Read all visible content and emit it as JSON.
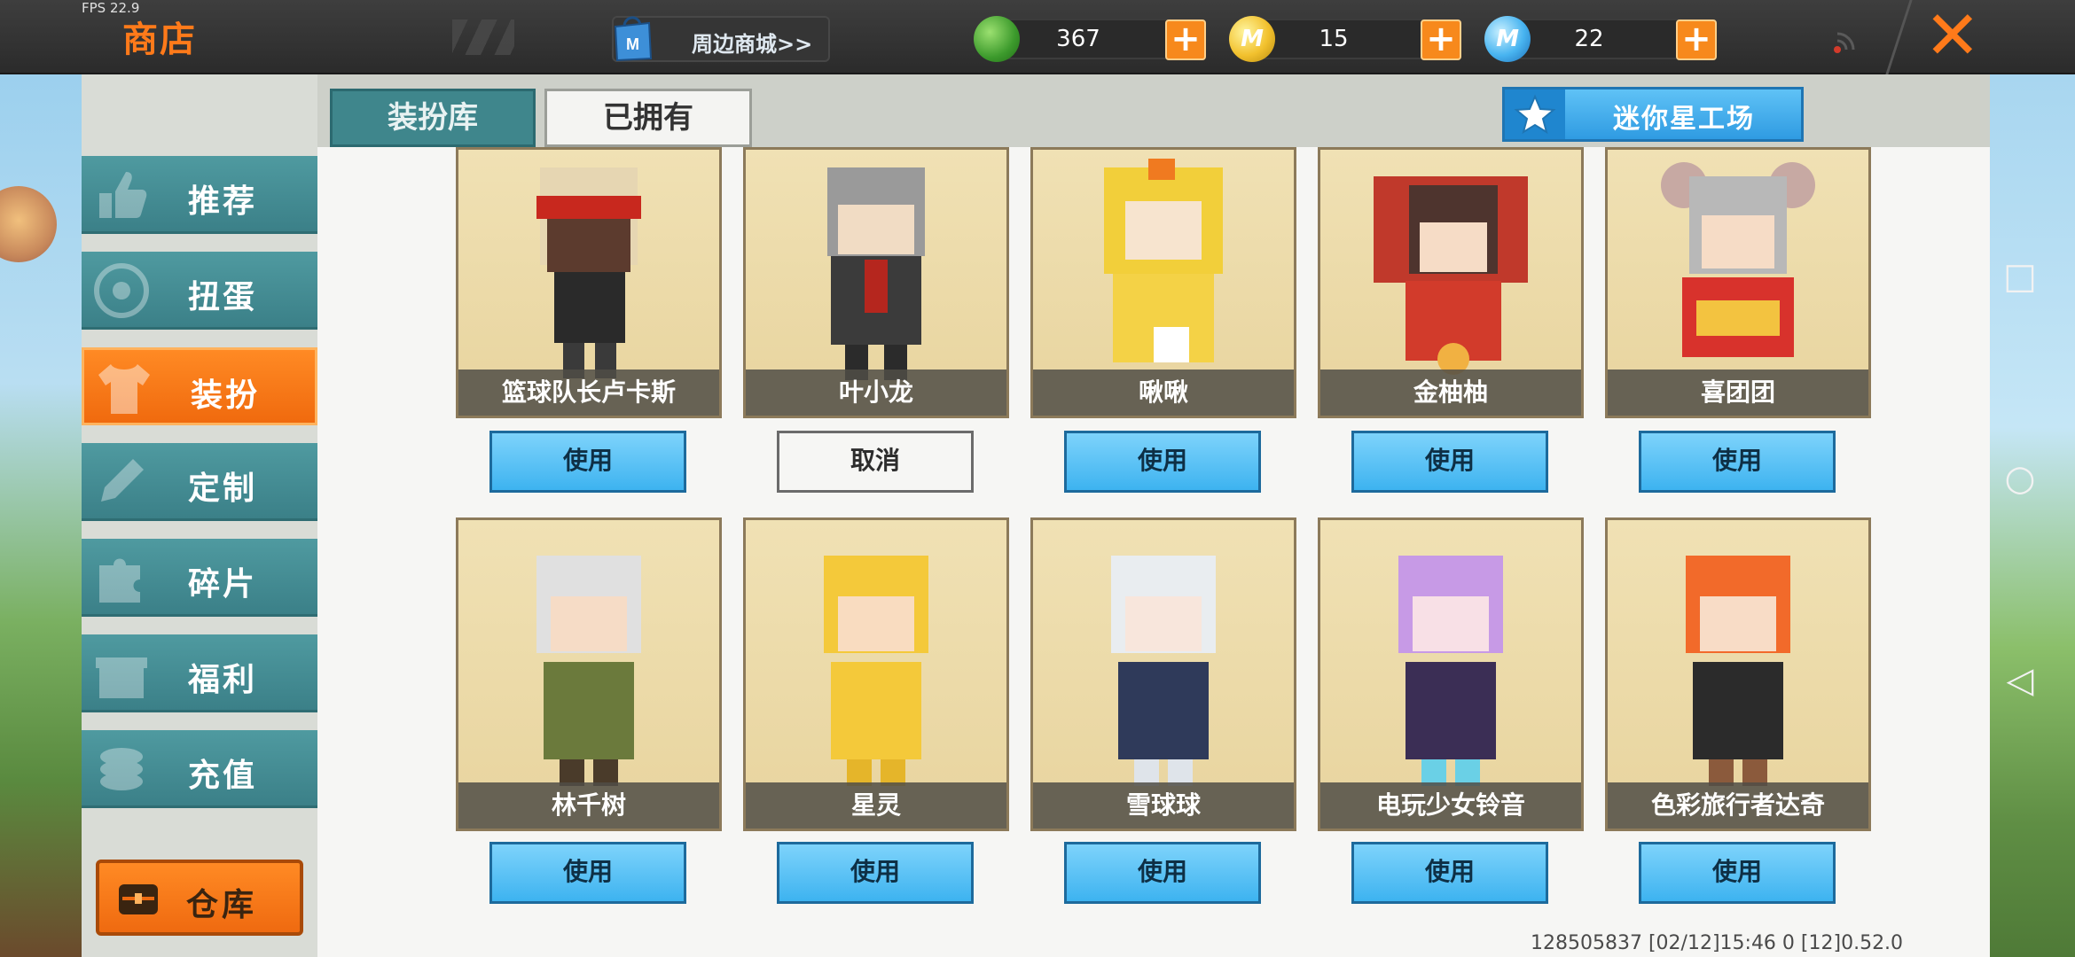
{
  "topbar": {
    "fps": "FPS 22.9",
    "title": "商店",
    "mall_link": "周边商城>>",
    "close_icon": "close-icon"
  },
  "currencies": [
    {
      "icon": "green-gem-icon",
      "value": "367"
    },
    {
      "icon": "gold-coin-icon",
      "value": "15"
    },
    {
      "icon": "mini-coin-icon",
      "value": "22"
    }
  ],
  "sidebar": {
    "items": [
      {
        "label": "推荐",
        "icon": "thumbs-up-icon"
      },
      {
        "label": "扭蛋",
        "icon": "capsule-icon"
      },
      {
        "label": "装扮",
        "icon": "tshirt-icon",
        "active": true
      },
      {
        "label": "定制",
        "icon": "pencil-icon"
      },
      {
        "label": "碎片",
        "icon": "puzzle-icon"
      },
      {
        "label": "福利",
        "icon": "gift-icon"
      },
      {
        "label": "充值",
        "icon": "coins-icon"
      }
    ],
    "warehouse": "仓库"
  },
  "tabs": [
    {
      "label": "装扮库",
      "selected": false
    },
    {
      "label": "已拥有",
      "selected": true
    }
  ],
  "workshop_label": "迷你星工场",
  "items": [
    {
      "name": "篮球队长卢卡斯",
      "action": "使用"
    },
    {
      "name": "叶小龙",
      "action": "取消"
    },
    {
      "name": "啾啾",
      "action": "使用"
    },
    {
      "name": "金柚柚",
      "action": "使用"
    },
    {
      "name": "喜团团",
      "action": "使用"
    },
    {
      "name": "林千树",
      "action": "使用"
    },
    {
      "name": "星灵",
      "action": "使用"
    },
    {
      "name": "雪球球",
      "action": "使用"
    },
    {
      "name": "电玩少女铃音",
      "action": "使用"
    },
    {
      "name": "色彩旅行者达奇",
      "action": "使用"
    }
  ],
  "footer": "128505837   [02/12]15:46 0  [12]0.52.0",
  "colors": {
    "accent_orange": "#ff7a1a",
    "teal": "#3f868c",
    "blue_button": "#3db3f0"
  }
}
